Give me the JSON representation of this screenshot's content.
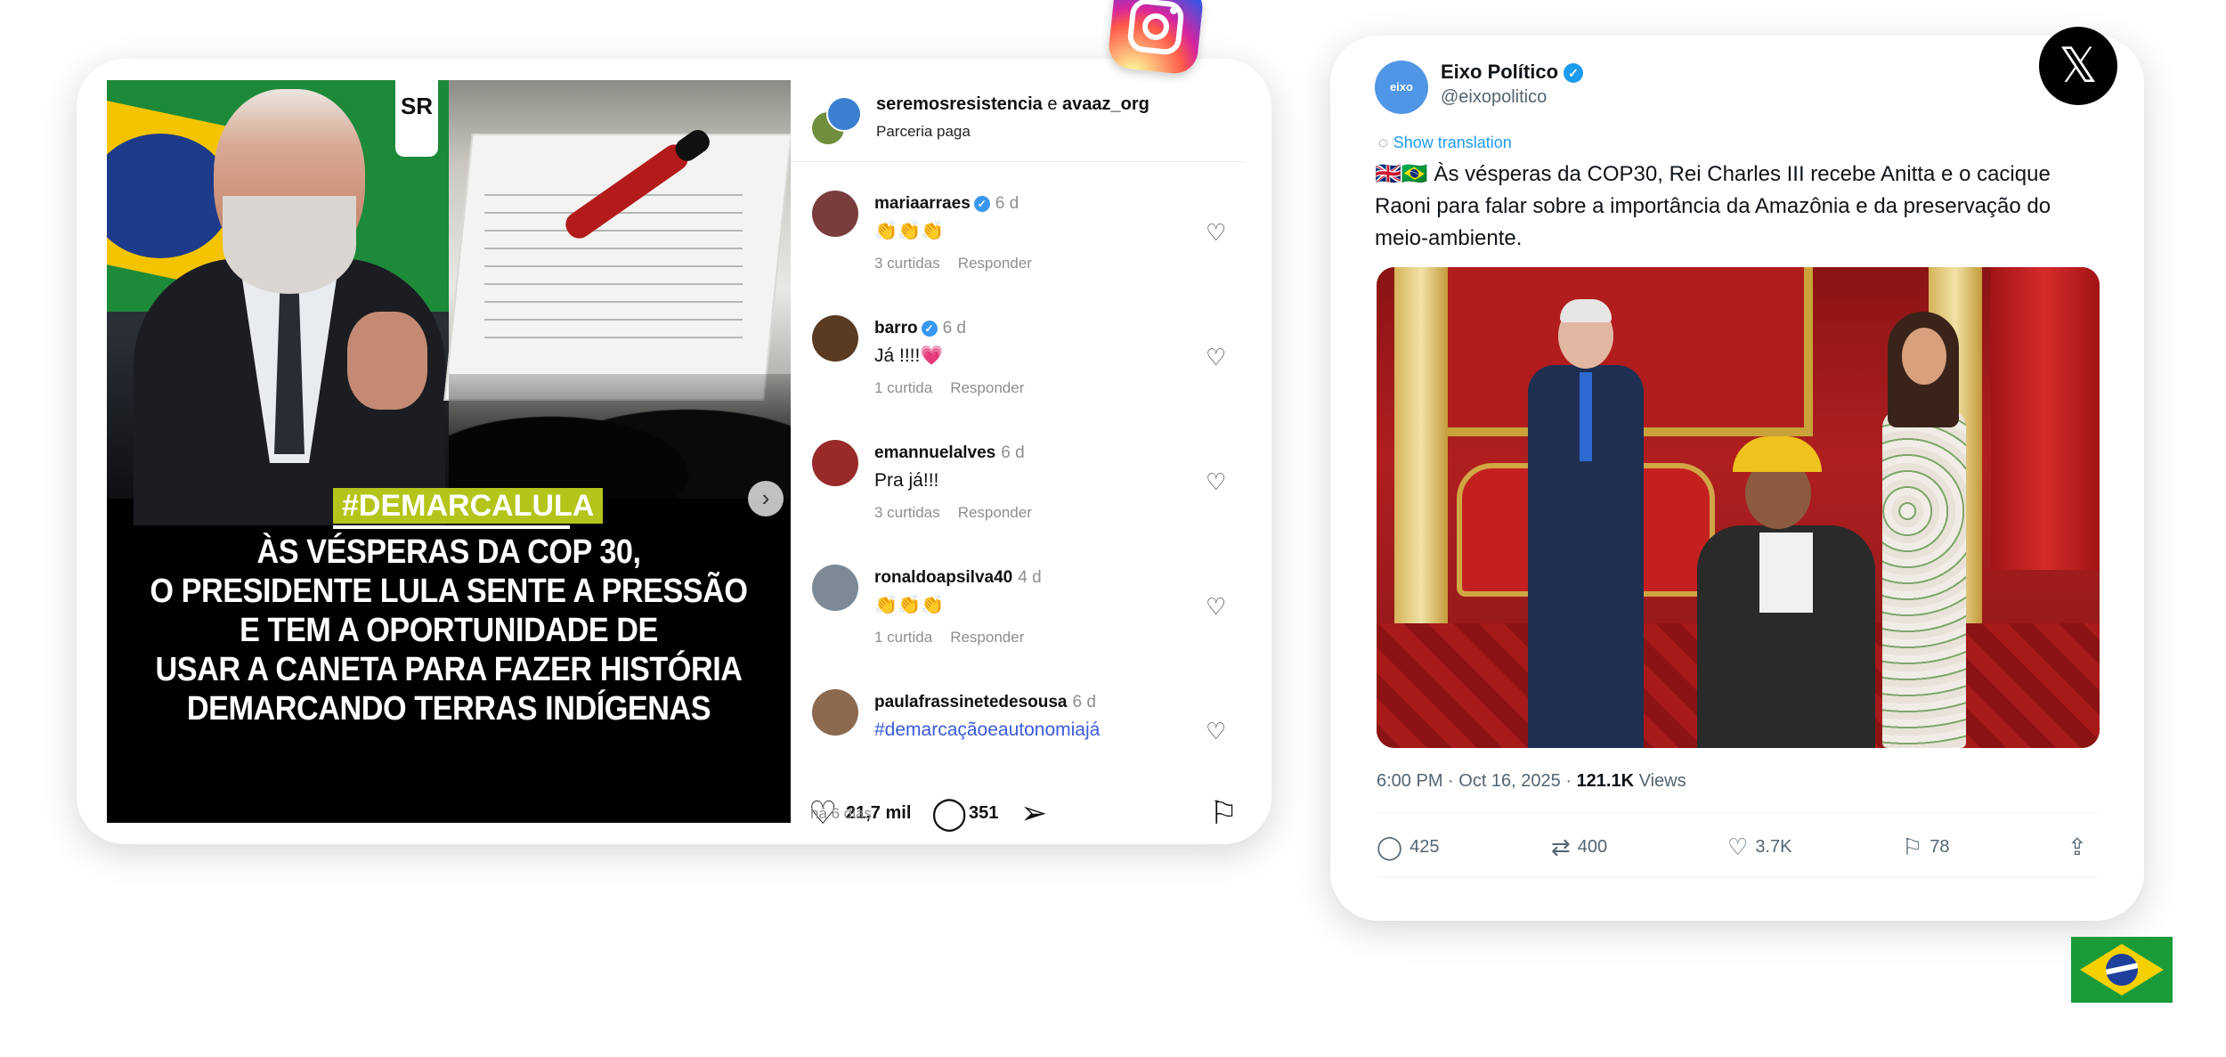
{
  "instagram": {
    "header": {
      "user": "seremosresistencia",
      "connector": "e",
      "collab": "avaaz_org",
      "subtitle": "Parceria paga"
    },
    "post": {
      "badge": "SR",
      "hashtag": "#DEMARCALULA",
      "headline": [
        "ÀS VÉSPERAS DA COP 30,",
        "O PRESIDENTE LULA SENTE A PRESSÃO",
        "E TEM A OPORTUNIDADE DE",
        "USAR A CANETA PARA FAZER HISTÓRIA",
        "DEMARCANDO TERRAS INDÍGENAS"
      ]
    },
    "comments": [
      {
        "user": "mariaarraes",
        "verified": true,
        "age": "6 d",
        "text": "👏👏👏",
        "likes": "3 curtidas",
        "reply": "Responder",
        "avatar_color": "#7a3d3d"
      },
      {
        "user": "barro",
        "verified": true,
        "age": "6 d",
        "text": "Já !!!!💗",
        "likes": "1 curtida",
        "reply": "Responder",
        "avatar_color": "#5a3a20"
      },
      {
        "user": "emannuelalves",
        "verified": false,
        "age": "6 d",
        "text": "Pra já!!!",
        "likes": "3 curtidas",
        "reply": "Responder",
        "avatar_color": "#9a2a2a"
      },
      {
        "user": "ronaldoapsilva40",
        "verified": false,
        "age": "4 d",
        "text": "👏👏👏",
        "likes": "1 curtida",
        "reply": "Responder",
        "avatar_color": "#7b8a95"
      },
      {
        "user": "paulafrassinetedesousa",
        "verified": false,
        "age": "6 d",
        "text": "#demarcaçãoeautonomiajá",
        "likes": "",
        "reply": "",
        "avatar_color": "#8c6a4f"
      }
    ],
    "actions": {
      "likes": "21,7 mil",
      "comments": "351",
      "time": "há 6 dias"
    }
  },
  "x_post": {
    "name": "Eixo Político",
    "handle": "@eixopolitico",
    "avatar_text": "eixo político",
    "translate": "Show translation",
    "text": "🇬🇧🇧🇷 Às vésperas da COP30, Rei Charles III recebe Anitta e o cacique Raoni para falar sobre a importância da Amazônia e da preservação do meio-ambiente.",
    "timestamp": "6:00 PM · Oct 16, 2025 · ",
    "views_count": "121.1K",
    "views_label": " Views",
    "stats": {
      "replies": "425",
      "reposts": "400",
      "likes": "3.7K",
      "bookmarks": "78"
    }
  },
  "icons": {
    "instagram_logo": "instagram-icon",
    "x_logo": "x-icon",
    "flag": "brazil-flag"
  },
  "colors": {
    "hashtag_bg": "#b5c41a",
    "ig_link": "#3a5bd9",
    "x_blue": "#1d9bf0"
  }
}
